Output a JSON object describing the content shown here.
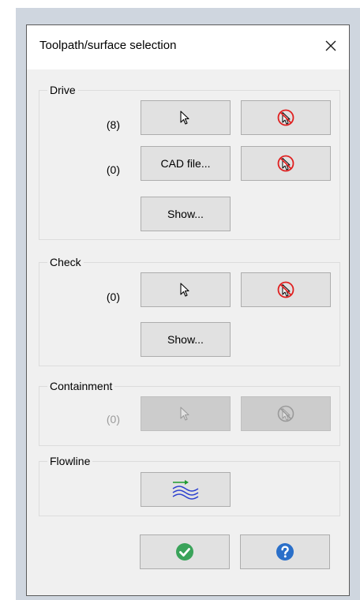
{
  "dialog": {
    "title": "Toolpath/surface selection"
  },
  "drive": {
    "legend": "Drive",
    "rows": [
      {
        "count": "(8)",
        "select_icon": "cursor-arrow-icon",
        "deselect_icon": "cursor-deselect-icon"
      },
      {
        "count": "(0)",
        "select_label": "CAD file...",
        "deselect_icon": "cursor-deselect-icon"
      }
    ],
    "show_label": "Show..."
  },
  "check": {
    "legend": "Check",
    "count": "(0)",
    "show_label": "Show..."
  },
  "containment": {
    "legend": "Containment",
    "count": "(0)",
    "enabled": false
  },
  "flowline": {
    "legend": "Flowline",
    "icon": "flowline-icon"
  },
  "footer": {
    "ok_icon": "check-circle-icon",
    "help_icon": "help-circle-icon"
  },
  "colors": {
    "deselect_red": "#e02020",
    "ok_green": "#3aa35a",
    "help_blue": "#2a6fc9",
    "flowline_green": "#1f9a2f",
    "flowline_blue": "#2a3fd0"
  }
}
